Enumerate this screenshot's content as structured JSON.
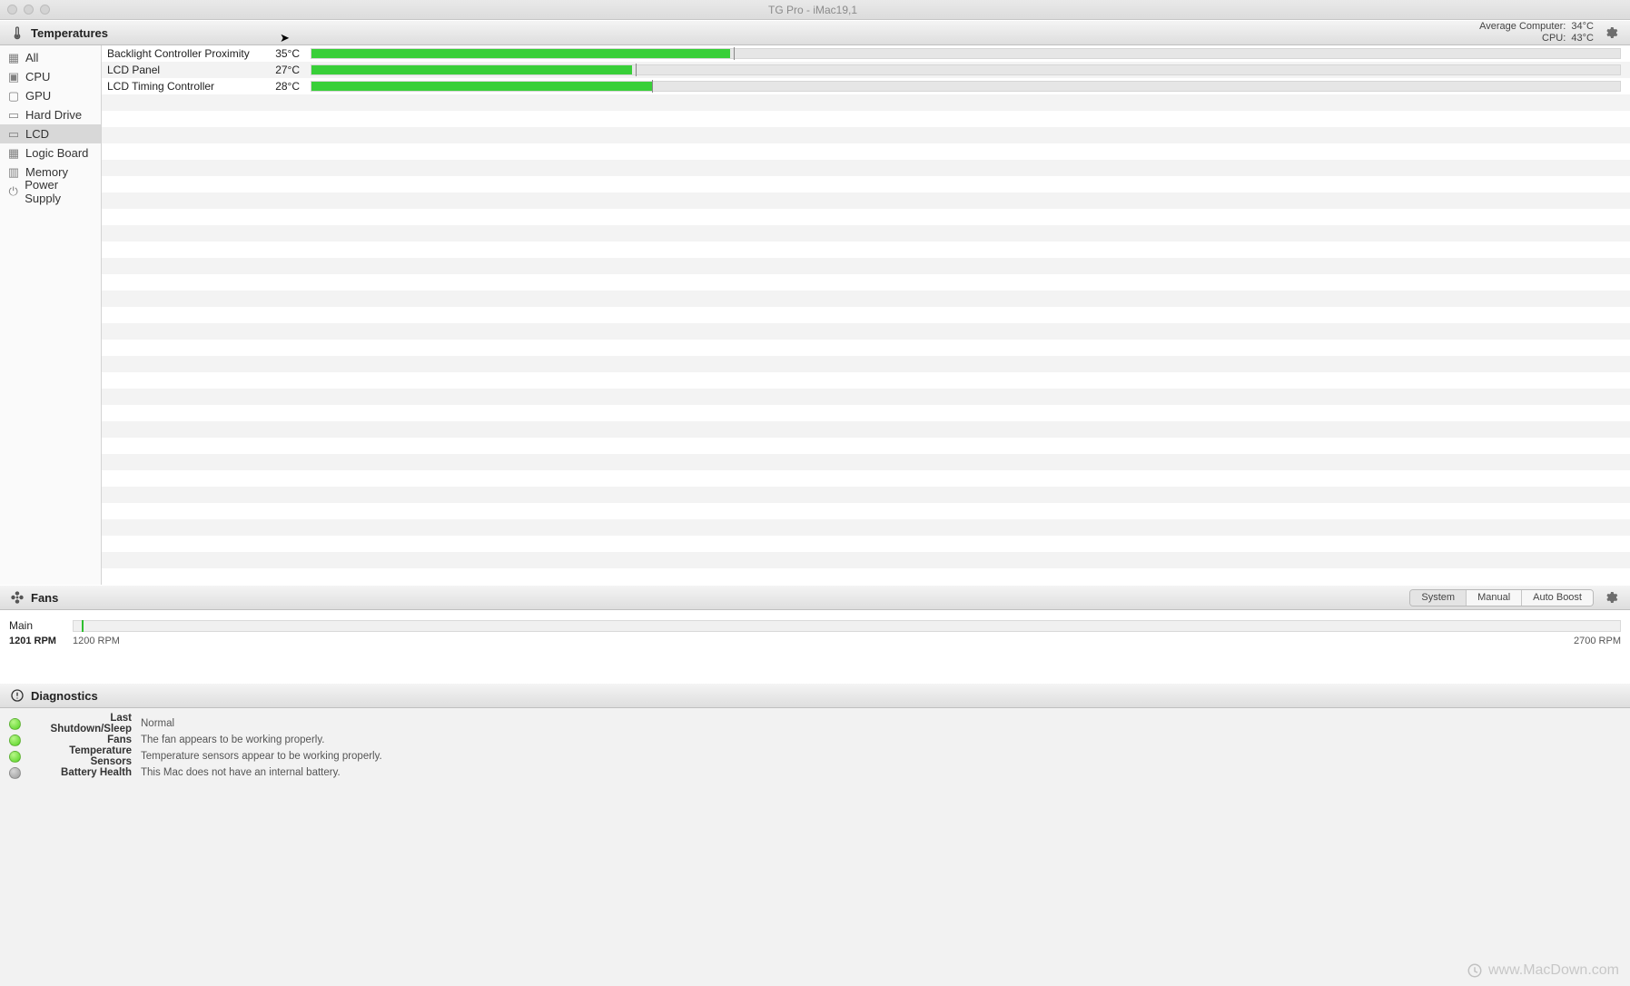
{
  "window": {
    "title": "TG Pro - iMac19,1"
  },
  "temperatures": {
    "header": "Temperatures",
    "avg_label": "Average Computer:",
    "avg_value": "34°C",
    "cpu_label": "CPU:",
    "cpu_value": "43°C",
    "categories": [
      {
        "label": "All"
      },
      {
        "label": "CPU"
      },
      {
        "label": "GPU"
      },
      {
        "label": "Hard Drive"
      },
      {
        "label": "LCD"
      },
      {
        "label": "Logic Board"
      },
      {
        "label": "Memory"
      },
      {
        "label": "Power Supply"
      }
    ],
    "selected_index": 4,
    "rows": [
      {
        "name": "Backlight Controller Proximity",
        "temp": "35°C",
        "pct": 32,
        "mark": 32.3
      },
      {
        "name": "LCD Panel",
        "temp": "27°C",
        "pct": 24.5,
        "mark": 24.8
      },
      {
        "name": "LCD Timing Controller",
        "temp": "28°C",
        "pct": 26,
        "mark": 26
      }
    ]
  },
  "fans": {
    "header": "Fans",
    "modes": [
      "System",
      "Manual",
      "Auto Boost"
    ],
    "mode_selected": 0,
    "fan": {
      "name": "Main",
      "current": "1201 RPM",
      "min": "1200 RPM",
      "max": "2700 RPM",
      "pos_pct": 0.5
    }
  },
  "diagnostics": {
    "header": "Diagnostics",
    "items": [
      {
        "status": "green",
        "label": "Last Shutdown/Sleep",
        "value": "Normal"
      },
      {
        "status": "green",
        "label": "Fans",
        "value": "The fan appears to be working properly."
      },
      {
        "status": "green",
        "label": "Temperature Sensors",
        "value": "Temperature sensors appear to be working properly."
      },
      {
        "status": "gray",
        "label": "Battery Health",
        "value": "This Mac does not have an internal battery."
      }
    ]
  },
  "watermark": "www.MacDown.com"
}
